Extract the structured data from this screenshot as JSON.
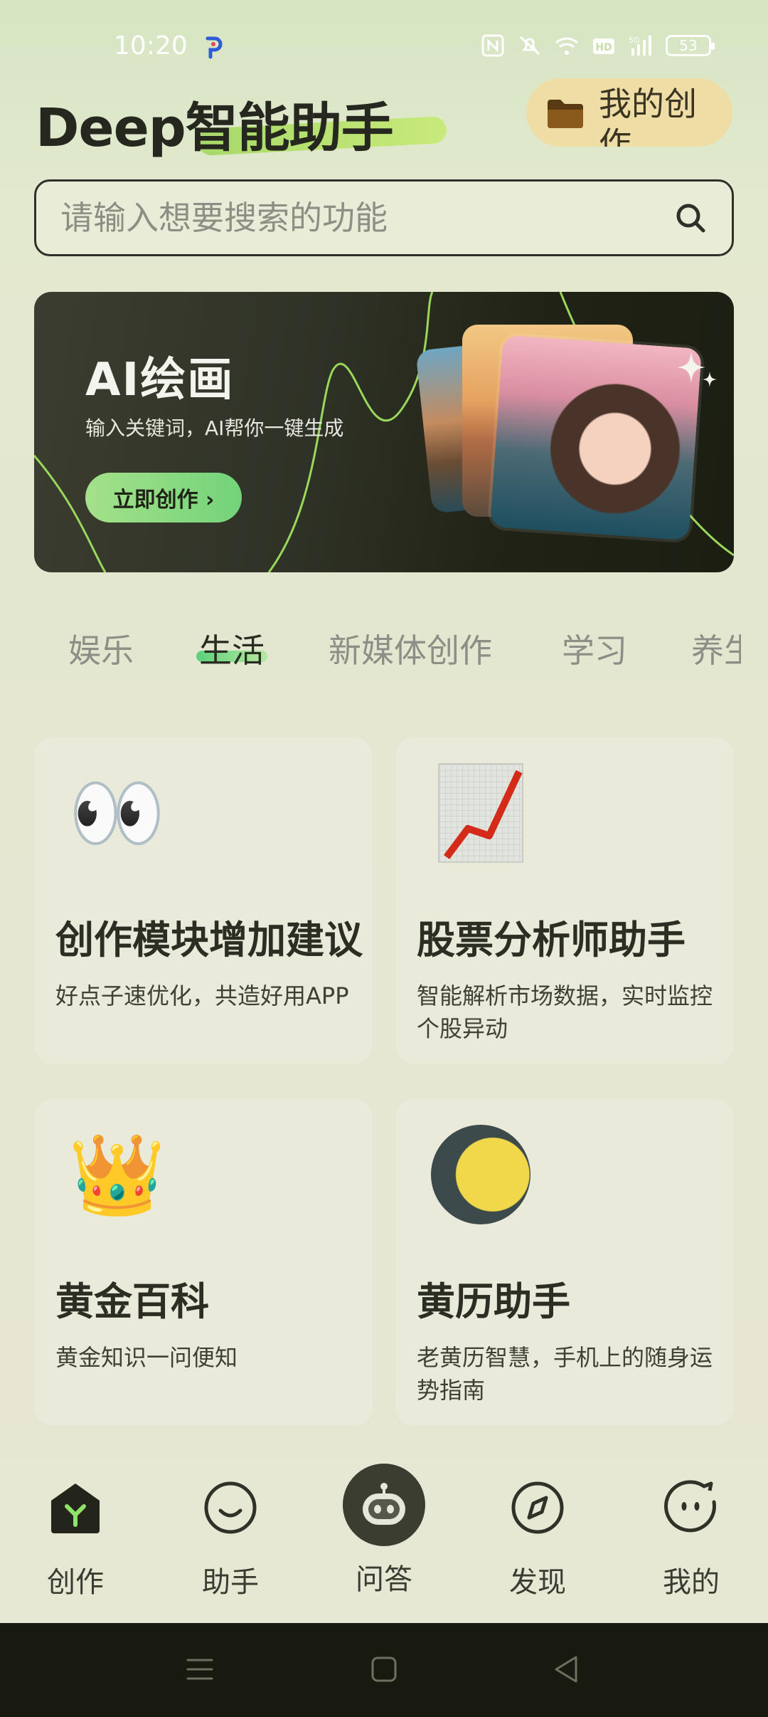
{
  "status_bar": {
    "time": "10:20",
    "battery": "53",
    "icons": [
      "nfc-icon",
      "mute-icon",
      "wifi-icon",
      "hd-icon",
      "signal-5g-icon",
      "battery-icon"
    ]
  },
  "header": {
    "logo_text": "Deep智能助手",
    "my_creations_label": "我的创作"
  },
  "search": {
    "placeholder": "请输入想要搜索的功能"
  },
  "banner": {
    "title": "AI绘画",
    "subtitle": "输入关键词，AI帮你一键生成",
    "button_label": "立即创作 ›"
  },
  "tabs": [
    {
      "label": "娱乐",
      "active": false
    },
    {
      "label": "生活",
      "active": true
    },
    {
      "label": "新媒体创作",
      "active": false
    },
    {
      "label": "学习",
      "active": false
    },
    {
      "label": "养生",
      "active": false
    }
  ],
  "cards": [
    {
      "icon": "👀",
      "title": "创作模块增加建议",
      "desc": "好点子速优化，共造好用APP"
    },
    {
      "icon": "chart-increasing-icon",
      "title": "股票分析师助手",
      "desc": "智能解析市场数据，实时监控个股异动"
    },
    {
      "icon": "👑",
      "title": "黄金百科",
      "desc": "黄金知识一问便知"
    },
    {
      "icon": "moon-icon",
      "title": "黄历助手",
      "desc": "老黄历智慧，手机上的随身运势指南"
    }
  ],
  "bottom_nav": [
    {
      "label": "创作",
      "icon": "create-icon",
      "active": true
    },
    {
      "label": "助手",
      "icon": "smile-icon",
      "active": false
    },
    {
      "label": "问答",
      "icon": "robot-icon",
      "active": false
    },
    {
      "label": "发现",
      "icon": "compass-icon",
      "active": false
    },
    {
      "label": "我的",
      "icon": "profile-face-icon",
      "active": false
    }
  ],
  "colors": {
    "accent_green": "#8ed96f",
    "dark": "#2f3226",
    "folder_pill": "#efdda6"
  }
}
